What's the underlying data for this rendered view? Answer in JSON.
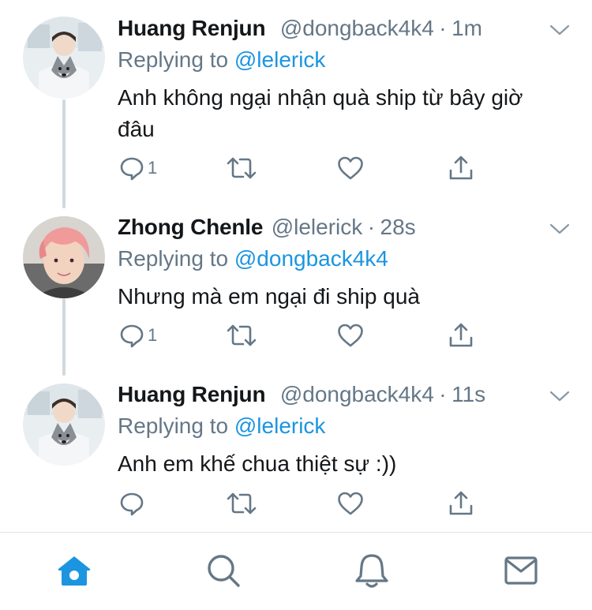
{
  "tweets": [
    {
      "name": "Huang Renjun",
      "handle": "@dongback4k4",
      "separator": "·",
      "time": "1m",
      "replying_prefix": "Replying to",
      "replying_to": "@lelerick",
      "text": "Anh không ngại nhận quà ship từ bây giờ đâu",
      "reply_count": "1",
      "avatar": "avatar-boy-with-husky"
    },
    {
      "name": "Zhong Chenle",
      "handle": "@lelerick",
      "separator": "·",
      "time": "28s",
      "replying_prefix": "Replying to",
      "replying_to": "@dongback4k4",
      "text": "Nhưng mà em ngại đi ship quà",
      "reply_count": "1",
      "avatar": "avatar-pink-hair"
    },
    {
      "name": "Huang Renjun",
      "handle": "@dongback4k4",
      "separator": "·",
      "time": "11s",
      "replying_prefix": "Replying to",
      "replying_to": "@lelerick",
      "text": "Anh em khế chua thiệt sự :))",
      "reply_count": "",
      "avatar": "avatar-boy-with-husky"
    }
  ],
  "tab_bar": {
    "items": [
      "home-icon",
      "search-icon",
      "notifications-icon",
      "messages-icon"
    ],
    "active": "home-icon"
  },
  "colors": {
    "accent": "#1b95e0",
    "secondary_text": "#657786",
    "primary_text": "#14171a",
    "icon_gray": "#657786",
    "thread_line": "#cfd9de"
  }
}
